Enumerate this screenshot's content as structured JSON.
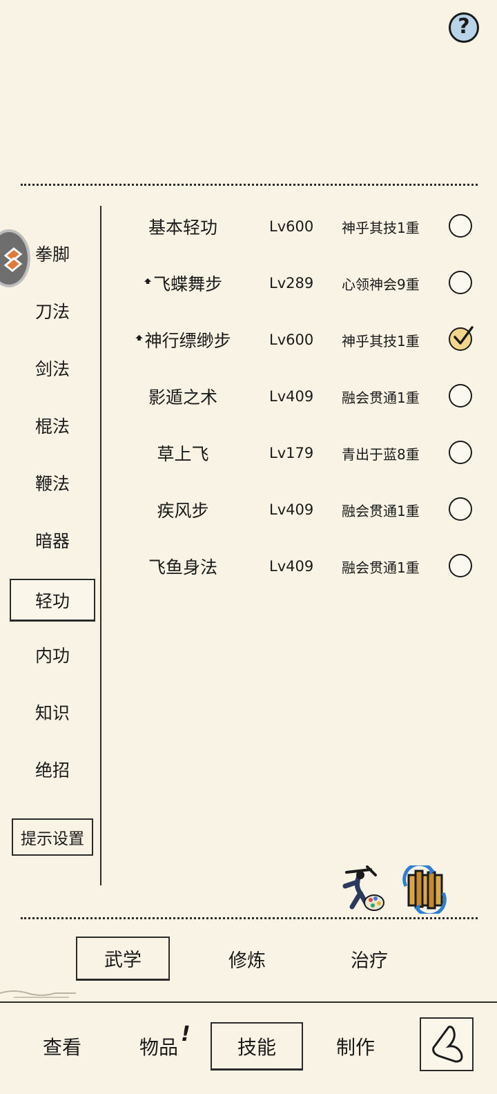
{
  "help": {
    "label": "?"
  },
  "categories": [
    {
      "label": "拳脚"
    },
    {
      "label": "刀法"
    },
    {
      "label": "剑法"
    },
    {
      "label": "棍法"
    },
    {
      "label": "鞭法"
    },
    {
      "label": "暗器"
    },
    {
      "label": "轻功"
    },
    {
      "label": "内功"
    },
    {
      "label": "知识"
    },
    {
      "label": "绝招"
    }
  ],
  "active_category": "轻功",
  "hint_settings": {
    "label": "提示设置"
  },
  "skills": [
    {
      "name": "基本轻功",
      "level": "Lv600",
      "realm": "神乎其技1重",
      "upgradable": false,
      "selected": false
    },
    {
      "name": "飞蝶舞步",
      "level": "Lv289",
      "realm": "心领神会9重",
      "upgradable": true,
      "selected": false
    },
    {
      "name": "神行缥缈步",
      "level": "Lv600",
      "realm": "神乎其技1重",
      "upgradable": true,
      "selected": true
    },
    {
      "name": "影遁之术",
      "level": "Lv409",
      "realm": "融会贯通1重",
      "upgradable": false,
      "selected": false
    },
    {
      "name": "草上飞",
      "level": "Lv179",
      "realm": "青出于蓝8重",
      "upgradable": false,
      "selected": false
    },
    {
      "name": "疾风步",
      "level": "Lv409",
      "realm": "融会贯通1重",
      "upgradable": false,
      "selected": false
    },
    {
      "name": "飞鱼身法",
      "level": "Lv409",
      "realm": "融会贯通1重",
      "upgradable": false,
      "selected": false
    }
  ],
  "subtabs": [
    {
      "label": "武学"
    },
    {
      "label": "修炼"
    },
    {
      "label": "治疗"
    }
  ],
  "navtabs": [
    {
      "label": "查看"
    },
    {
      "label": "物品"
    },
    {
      "label": "技能"
    },
    {
      "label": "制作"
    }
  ],
  "item_alert": "!",
  "icons": {
    "help": "question-icon",
    "upgrade": "upgrade-arrow-icon",
    "martial": "martial-artist-palette-icon",
    "swap": "scroll-swap-icon",
    "back": "back-arrow-icon"
  },
  "colors": {
    "background": "#f8f3e4",
    "check_active": "#f1d58a",
    "help_bg": "#b9d3e8"
  }
}
